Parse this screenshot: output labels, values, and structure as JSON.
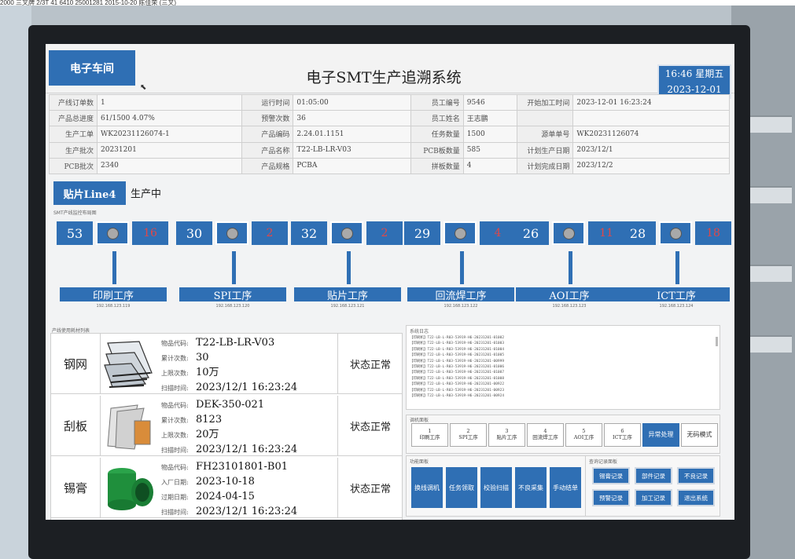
{
  "photo_top_strip": "2000 三叉牌 2/3T 41 6410 25001281 2015-10-20 陈佳荣 (三叉)",
  "header": {
    "workshop_button": "电子车间",
    "title": "电子SMT生产追溯系统",
    "clock_time": "16:46 星期五",
    "clock_date": "2023-12-01"
  },
  "info": {
    "rows": [
      [
        {
          "k": "产线订单数",
          "v": "1"
        },
        {
          "k": "运行时间",
          "v": "01:05:00"
        },
        {
          "k": "员工编号",
          "v": "9546"
        },
        {
          "k": "开始加工时间",
          "v": "2023-12-01 16:23:24"
        }
      ],
      [
        {
          "k": "产品总进度",
          "v": "61/1500 4.07%"
        },
        {
          "k": "预警次数",
          "v": "36"
        },
        {
          "k": "员工姓名",
          "v": "王志鹏"
        },
        {
          "k": "",
          "v": ""
        }
      ],
      [
        {
          "k": "生产工单",
          "v": "WK20231126074-1"
        },
        {
          "k": "产品编码",
          "v": "2.24.01.1151"
        },
        {
          "k": "任务数量",
          "v": "1500"
        },
        {
          "k": "源单单号",
          "v": "WK20231126074"
        }
      ],
      [
        {
          "k": "生产批次",
          "v": "20231201"
        },
        {
          "k": "产品名称",
          "v": "T22-LB-LR-V03"
        },
        {
          "k": "PCB板数量",
          "v": "585"
        },
        {
          "k": "计划生产日期",
          "v": "2023/12/1"
        }
      ],
      [
        {
          "k": "PCB批次",
          "v": "2340"
        },
        {
          "k": "产品规格",
          "v": "PCBA"
        },
        {
          "k": "拼板数量",
          "v": "4"
        },
        {
          "k": "计划完成日期",
          "v": "2023/12/2"
        }
      ]
    ]
  },
  "line": {
    "tag": "贴片Line4",
    "state": "生产中",
    "monitor_caption": "SMT产线监控布局图"
  },
  "processes": [
    {
      "count": "53",
      "ng": "16",
      "name": "印刷工序",
      "ip": "192.168.123.119"
    },
    {
      "count": "30",
      "ng": "2",
      "name": "SPI工序",
      "ip": "192.168.123.120"
    },
    {
      "count": "32",
      "ng": "2",
      "name": "贴片工序",
      "ip": "192.168.123.121"
    },
    {
      "count": "29",
      "ng": "4",
      "name": "回流焊工序",
      "ip": "192.168.123.122"
    },
    {
      "count": "26",
      "ng": "11",
      "name": "AOI工序",
      "ip": "192.168.123.123"
    },
    {
      "count": "28",
      "ng": "18",
      "name": "ICT工序",
      "ip": "192.168.123.124"
    }
  ],
  "consumables": {
    "caption": "产线使用耗材列表",
    "items": [
      {
        "name": "钢网",
        "f1k": "物品代码:",
        "f1v": "T22-LB-LR-V03",
        "f2k": "累计次数:",
        "f2v": "30",
        "f3k": "上限次数:",
        "f3v": "10万",
        "f4k": "扫描时间:",
        "f4v": "2023/12/1 16:23:24",
        "status": "状态正常"
      },
      {
        "name": "刮板",
        "f1k": "物品代码:",
        "f1v": "DEK-350-021",
        "f2k": "累计次数:",
        "f2v": "8123",
        "f3k": "上限次数:",
        "f3v": "20万",
        "f4k": "扫描时间:",
        "f4v": "2023/12/1 16:23:24",
        "status": "状态正常"
      },
      {
        "name": "锡膏",
        "f1k": "物品代码:",
        "f1v": "FH23101801-B01",
        "f2k": "入厂日期:",
        "f2v": "2023-10-18",
        "f3k": "过期日期:",
        "f3v": "2024-04-15",
        "f4k": "扫描时间:",
        "f4v": "2023/12/1 16:23:24",
        "status": "状态正常"
      }
    ]
  },
  "log": {
    "caption": "系统日志",
    "lines": [
      "【印刷机】T22-LB-L-R03-53919-H6-20231201-01002",
      "【印刷机】T22-LB-L-R03-53919-H6-20231201-01003",
      "【印刷机】T22-LB-L-R03-53919-H6-20231201-01004",
      "【印刷机】T22-LB-L-R03-53919-H6-20231201-01005",
      "【印刷机】T22-LB-L-R03-53919-H6-20231201-00999",
      "【印刷机】T22-LB-L-R03-53919-H6-20231201-01006",
      "【印刷机】T22-LB-L-R03-53919-H6-20231201-01007",
      "【印刷机】T22-LB-L-R03-53919-H6-20231201-01008",
      "【印刷机】T22-LB-L-R03-53919-H6-20231201-00922",
      "【印刷机】T22-LB-L-R03-53919-H6-20231201-00923",
      "【印刷机】T22-LB-L-R03-53919-H6-20231201-00924"
    ]
  },
  "steps": {
    "caption": "调机面板",
    "items": [
      {
        "n": "1",
        "label": "印刷工序"
      },
      {
        "n": "2",
        "label": "SPI工序"
      },
      {
        "n": "3",
        "label": "贴片工序"
      },
      {
        "n": "4",
        "label": "回流焊工序"
      },
      {
        "n": "5",
        "label": "AOI工序"
      },
      {
        "n": "6",
        "label": "ICT工序"
      }
    ],
    "active_label": "异常处理",
    "extra_label": "无码模式"
  },
  "functions": {
    "caption": "功能面板",
    "buttons": [
      "换线调机",
      "任务领取",
      "校验扫描",
      "不良采集",
      "手动结单"
    ]
  },
  "query": {
    "caption": "查询记录面板",
    "buttons": [
      "锡膏记录",
      "部件记录",
      "不良记录",
      "预警记录",
      "加工记录",
      "退出系统"
    ]
  },
  "colors": {
    "accent": "#2f6fb4",
    "ng_red": "#e04848",
    "bezel": "#1c1f23"
  }
}
